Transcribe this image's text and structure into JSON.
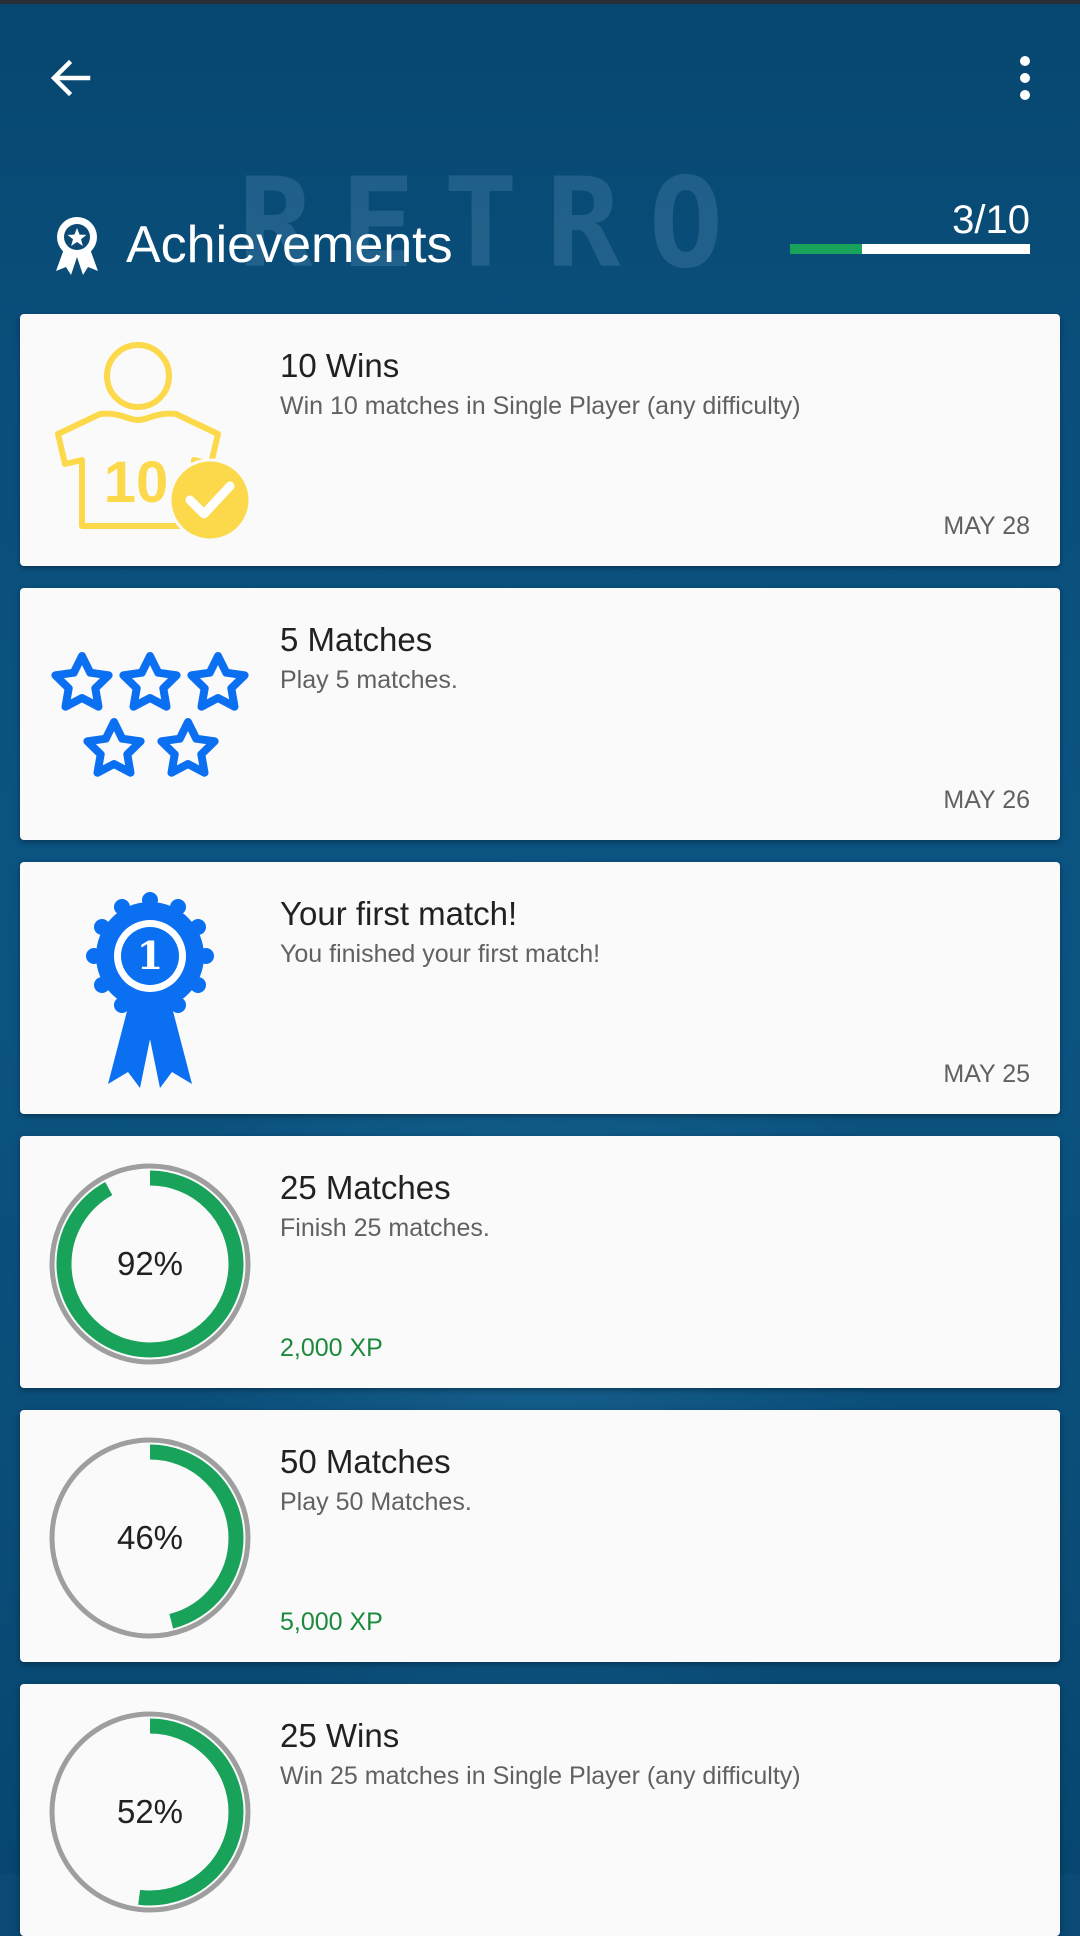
{
  "header": {
    "title": "Achievements",
    "watermark": "RETRO",
    "progress_text": "3/10",
    "progress_fraction": 0.3
  },
  "colors": {
    "accent_green": "#19a35a",
    "xp_green": "#1b8a3c",
    "trophy_yellow": "#fcd94a",
    "badge_blue": "#0b6ff2"
  },
  "achievements": [
    {
      "title": "10 Wins",
      "description": "Win 10 matches in Single Player (any difficulty)",
      "date": "MAY 28",
      "icon": "shirt-10-check-icon",
      "shirt_number": "10"
    },
    {
      "title": "5 Matches",
      "description": "Play 5 matches.",
      "date": "MAY 26",
      "icon": "five-stars-icon"
    },
    {
      "title": "Your first match!",
      "description": "You finished your first match!",
      "date": "MAY 25",
      "icon": "first-place-ribbon-icon",
      "ribbon_number": "1"
    },
    {
      "title": "25 Matches",
      "description": "Finish 25 matches.",
      "xp": "2,000 XP",
      "percent_text": "92%",
      "progress": 0.92
    },
    {
      "title": "50 Matches",
      "description": "Play 50 Matches.",
      "xp": "5,000 XP",
      "percent_text": "46%",
      "progress": 0.46
    },
    {
      "title": "25 Wins",
      "description": "Win 25 matches in Single Player (any difficulty)",
      "percent_text": "52%",
      "progress": 0.52
    }
  ]
}
